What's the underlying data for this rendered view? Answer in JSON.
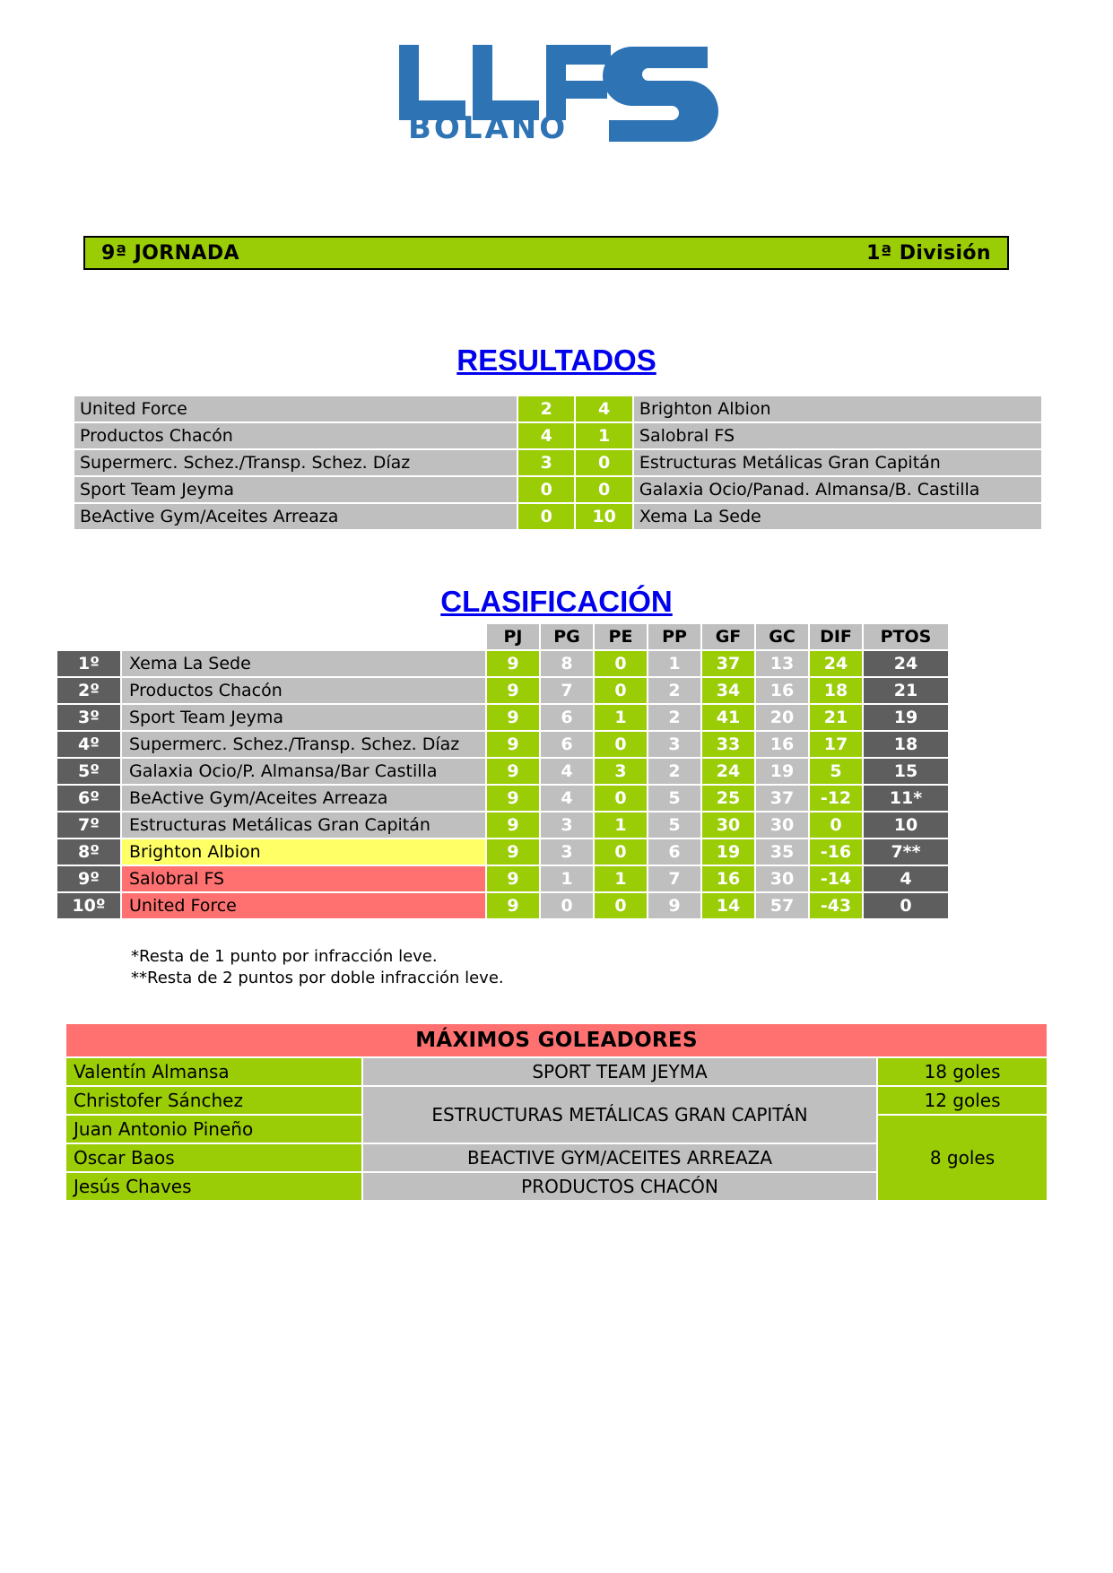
{
  "logo": {
    "main_text": "LLFS",
    "sub_text": "BOLAÑO",
    "color": "#2E74B5"
  },
  "header": {
    "jornada": "9ª JORNADA",
    "division": "1ª División",
    "bar_color": "#9ACD06"
  },
  "results": {
    "title": "RESULTADOS",
    "rows": [
      {
        "home": "United Force",
        "home_score": "2",
        "away_score": "4",
        "away": "Brighton Albion"
      },
      {
        "home": "Productos Chacón",
        "home_score": "4",
        "away_score": "1",
        "away": "Salobral FS"
      },
      {
        "home": "Supermerc. Schez./Transp. Schez. Díaz",
        "home_score": "3",
        "away_score": "0",
        "away": "Estructuras Metálicas Gran Capitán"
      },
      {
        "home": "Sport Team Jeyma",
        "home_score": "0",
        "away_score": "0",
        "away": "Galaxia Ocio/Panad. Almansa/B. Castilla"
      },
      {
        "home": "BeActive Gym/Aceites Arreaza",
        "home_score": "0",
        "away_score": "10",
        "away": "Xema La Sede"
      }
    ]
  },
  "standings": {
    "title": "CLASIFICACIÓN",
    "columns": [
      "PJ",
      "PG",
      "PE",
      "PP",
      "GF",
      "GC",
      "DIF",
      "PTOS"
    ],
    "rows": [
      {
        "pos": "1º",
        "team": "Xema La Sede",
        "pj": "9",
        "pg": "8",
        "pe": "0",
        "pp": "1",
        "gf": "37",
        "gc": "13",
        "dif": "24",
        "ptos": "24",
        "highlight": "none"
      },
      {
        "pos": "2º",
        "team": "Productos Chacón",
        "pj": "9",
        "pg": "7",
        "pe": "0",
        "pp": "2",
        "gf": "34",
        "gc": "16",
        "dif": "18",
        "ptos": "21",
        "highlight": "none"
      },
      {
        "pos": "3º",
        "team": "Sport Team Jeyma",
        "pj": "9",
        "pg": "6",
        "pe": "1",
        "pp": "2",
        "gf": "41",
        "gc": "20",
        "dif": "21",
        "ptos": "19",
        "highlight": "none"
      },
      {
        "pos": "4º",
        "team": "Supermerc. Schez./Transp. Schez. Díaz",
        "pj": "9",
        "pg": "6",
        "pe": "0",
        "pp": "3",
        "gf": "33",
        "gc": "16",
        "dif": "17",
        "ptos": "18",
        "highlight": "none"
      },
      {
        "pos": "5º",
        "team": "Galaxia Ocio/P. Almansa/Bar Castilla",
        "pj": "9",
        "pg": "4",
        "pe": "3",
        "pp": "2",
        "gf": "24",
        "gc": "19",
        "dif": "5",
        "ptos": "15",
        "highlight": "none"
      },
      {
        "pos": "6º",
        "team": "BeActive Gym/Aceites Arreaza",
        "pj": "9",
        "pg": "4",
        "pe": "0",
        "pp": "5",
        "gf": "25",
        "gc": "37",
        "dif": "-12",
        "ptos": "11*",
        "highlight": "none"
      },
      {
        "pos": "7º",
        "team": "Estructuras Metálicas Gran Capitán",
        "pj": "9",
        "pg": "3",
        "pe": "1",
        "pp": "5",
        "gf": "30",
        "gc": "30",
        "dif": "0",
        "ptos": "10",
        "highlight": "none"
      },
      {
        "pos": "8º",
        "team": "Brighton Albion",
        "pj": "9",
        "pg": "3",
        "pe": "0",
        "pp": "6",
        "gf": "19",
        "gc": "35",
        "dif": "-16",
        "ptos": "7**",
        "highlight": "yellow"
      },
      {
        "pos": "9º",
        "team": "Salobral FS",
        "pj": "9",
        "pg": "1",
        "pe": "1",
        "pp": "7",
        "gf": "16",
        "gc": "30",
        "dif": "-14",
        "ptos": "4",
        "highlight": "red"
      },
      {
        "pos": "10º",
        "team": "United Force",
        "pj": "9",
        "pg": "0",
        "pe": "0",
        "pp": "9",
        "gf": "14",
        "gc": "57",
        "dif": "-43",
        "ptos": "0",
        "highlight": "red"
      }
    ],
    "footnote_1": "*Resta de 1 punto por infracción leve.",
    "footnote_2": "**Resta de 2 puntos por doble infracción leve."
  },
  "scorers": {
    "title": "MÁXIMOS GOLEADORES",
    "rows": [
      {
        "player": "Valentín Almansa",
        "team": "SPORT TEAM JEYMA",
        "goals": "18 goles",
        "team_rowspan": 1,
        "goals_rowspan": 1
      },
      {
        "player": "Christofer Sánchez",
        "team": "ESTRUCTURAS METÁLICAS GRAN CAPITÁN",
        "goals": "12 goles",
        "team_rowspan": 2,
        "goals_rowspan": 1
      },
      {
        "player": "Juan Antonio Pineño",
        "team": "",
        "goals": "8 goles",
        "team_rowspan": 0,
        "goals_rowspan": 3
      },
      {
        "player": "Oscar Baos",
        "team": "BEACTIVE GYM/ACEITES ARREAZA",
        "goals": "",
        "team_rowspan": 1,
        "goals_rowspan": 0
      },
      {
        "player": "Jesús Chaves",
        "team": "PRODUCTOS CHACÓN",
        "goals": "",
        "team_rowspan": 1,
        "goals_rowspan": 0
      }
    ]
  }
}
